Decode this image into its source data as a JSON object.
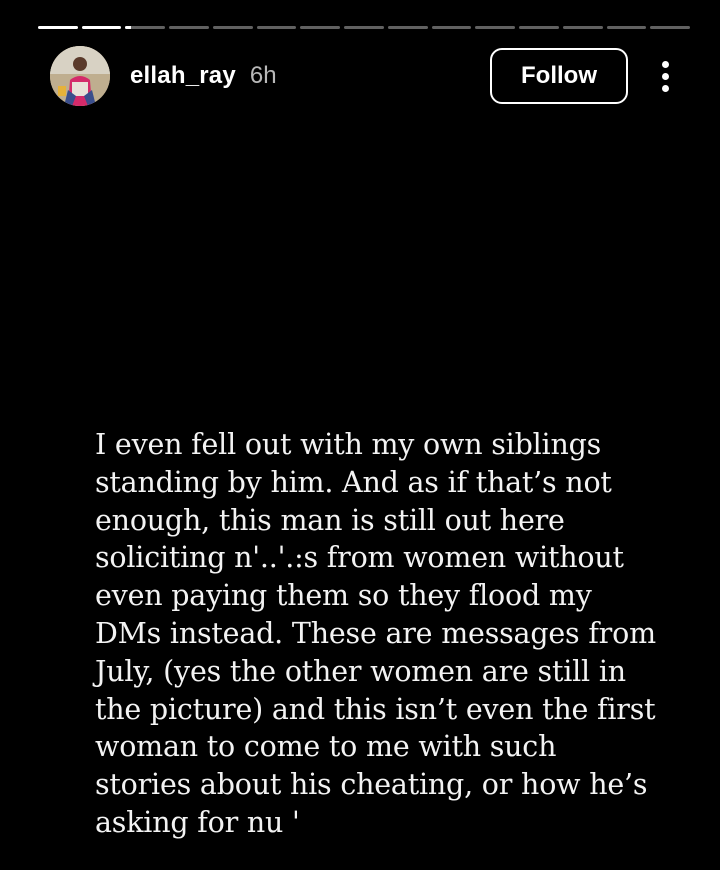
{
  "story": {
    "segments": [
      1,
      1,
      0.15,
      0,
      0,
      0,
      0,
      0,
      0,
      0,
      0,
      0,
      0,
      0,
      0
    ],
    "username": "ellah_ray",
    "time": "6h",
    "follow_label": "Follow",
    "body_text": "I even fell out with my own siblings\nstanding by him. And as if that’s not\nenough, this man is still out here\nsoliciting n'..'.:s from women without\neven paying them so they flood my\nDMs instead. These are messages from\nJuly, (yes the other women are still in\nthe picture) and this isn’t even the first\nwoman to come to me with such\nstories about his cheating, or how he’s\nasking for nu    '"
  },
  "icons": {
    "avatar": "profile-photo",
    "more": "more-vertical-icon"
  }
}
